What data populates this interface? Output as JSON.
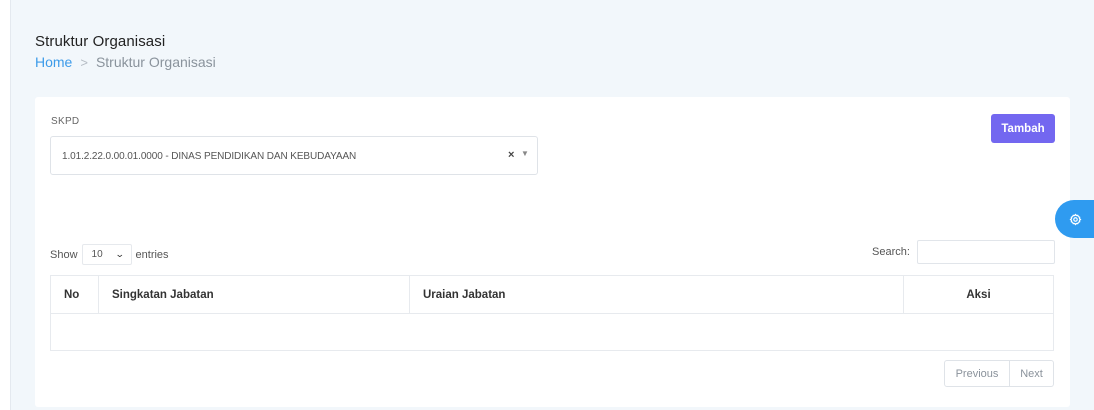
{
  "header": {
    "title": "Struktur Organisasi",
    "breadcrumb": {
      "home": "Home",
      "separator": ">",
      "current": "Struktur Organisasi"
    }
  },
  "filter": {
    "label": "SKPD",
    "selected": "1.01.2.22.0.00.01.0000 - DINAS PENDIDIKAN DAN KEBUDAYAAN",
    "clear_icon": "×",
    "arrow_icon": "▼"
  },
  "toolbar": {
    "add_label": "Tambah"
  },
  "table_controls": {
    "show_label": "Show",
    "page_length": "10",
    "entries_label": "entries",
    "search_label": "Search:",
    "search_value": ""
  },
  "table": {
    "columns": [
      "No",
      "Singkatan Jabatan",
      "Uraian Jabatan",
      "Aksi"
    ],
    "rows": []
  },
  "pagination": {
    "previous": "Previous",
    "next": "Next"
  },
  "colors": {
    "accent": "#7367f0",
    "link": "#3d9be9",
    "settings_tab": "#2f9bf0"
  },
  "icons": {
    "settings": "gear-icon"
  }
}
